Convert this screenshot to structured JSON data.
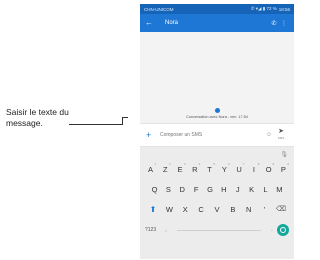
{
  "callout": {
    "text": "Saisir le texte du message."
  },
  "status_bar": {
    "carrier": "CHN-UNICOM",
    "indicators": "✆ ▾◢ ▮ 72 %",
    "time": "18:56"
  },
  "app_bar": {
    "back_icon": "←",
    "title": "Nora",
    "call_icon": "✆",
    "menu_icon": "⋮"
  },
  "conversation": {
    "caption": "Conversation avec Nora - ven. 17:54"
  },
  "compose": {
    "plus": "+",
    "placeholder": "Composer un SMS",
    "emoji": "☺",
    "send": "➤",
    "send_sub": "SMS"
  },
  "keyboard": {
    "mic": "🎙",
    "row1": [
      "A",
      "Z",
      "E",
      "R",
      "T",
      "Y",
      "U",
      "I",
      "O",
      "P"
    ],
    "row1_hints": [
      "1",
      "2",
      "3",
      "4",
      "5",
      "6",
      "7",
      "8",
      "9",
      "0"
    ],
    "row2": [
      "Q",
      "S",
      "D",
      "F",
      "G",
      "H",
      "J",
      "K",
      "L",
      "M"
    ],
    "row3": [
      "W",
      "X",
      "C",
      "V",
      "B",
      "N",
      "'"
    ],
    "shift": "⬆",
    "backspace": "⌫",
    "sym": "?123",
    "comma": ",",
    "dot": "."
  },
  "colors": {
    "status": "#1664b8",
    "app_bar": "#1e77d4",
    "enter": "#14a89a"
  }
}
